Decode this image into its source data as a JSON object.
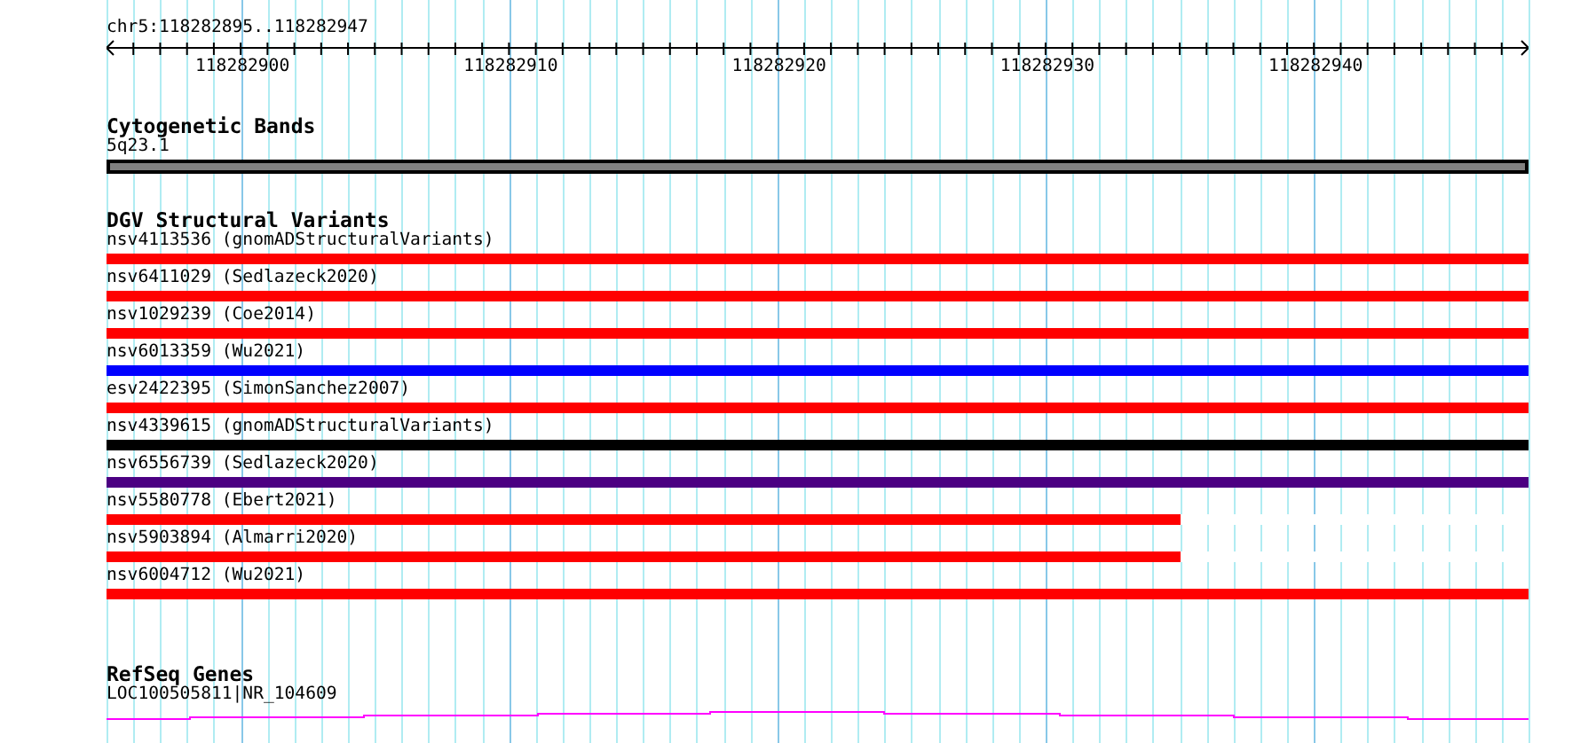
{
  "ruler": {
    "range": "chr5:118282895..118282947",
    "tick_labels": [
      "118282900",
      "118282910",
      "118282920",
      "118282930",
      "118282940"
    ]
  },
  "tracks": [
    {
      "kind": "band",
      "title": "Cytogenetic Bands",
      "features": [
        {
          "label": "5q23.1",
          "color": "#808080"
        }
      ]
    },
    {
      "kind": "variants",
      "title": "DGV Structural Variants",
      "features": [
        {
          "label": "nsv4113536 (gnomADStructuralVariants)",
          "color": "#ff0000"
        },
        {
          "label": "nsv6411029 (Sedlazeck2020)",
          "color": "#ff0000"
        },
        {
          "label": "nsv1029239 (Coe2014)",
          "color": "#ff0000"
        },
        {
          "label": "nsv6013359 (Wu2021)",
          "color": "#0000ff"
        },
        {
          "label": "esv2422395 (SimonSanchez2007)",
          "color": "#ff0000"
        },
        {
          "label": "nsv4339615 (gnomADStructuralVariants)",
          "color": "#000000"
        },
        {
          "label": "nsv6556739 (Sedlazeck2020)",
          "color": "#4b0082"
        },
        {
          "label": "nsv5580778 (Ebert2021)",
          "color": "#ff0000",
          "level": 0.755
        },
        {
          "label": "nsv5903894 (Almarri2020)",
          "color": "#ff0000",
          "level": 0.755
        },
        {
          "label": "nsv6004712 (Wu2021)",
          "color": "#ff0000"
        }
      ]
    },
    {
      "kind": "genes",
      "title": "RefSeq Genes",
      "features": [
        {
          "label": "LOC100505811|NR_104609"
        }
      ]
    }
  ]
}
